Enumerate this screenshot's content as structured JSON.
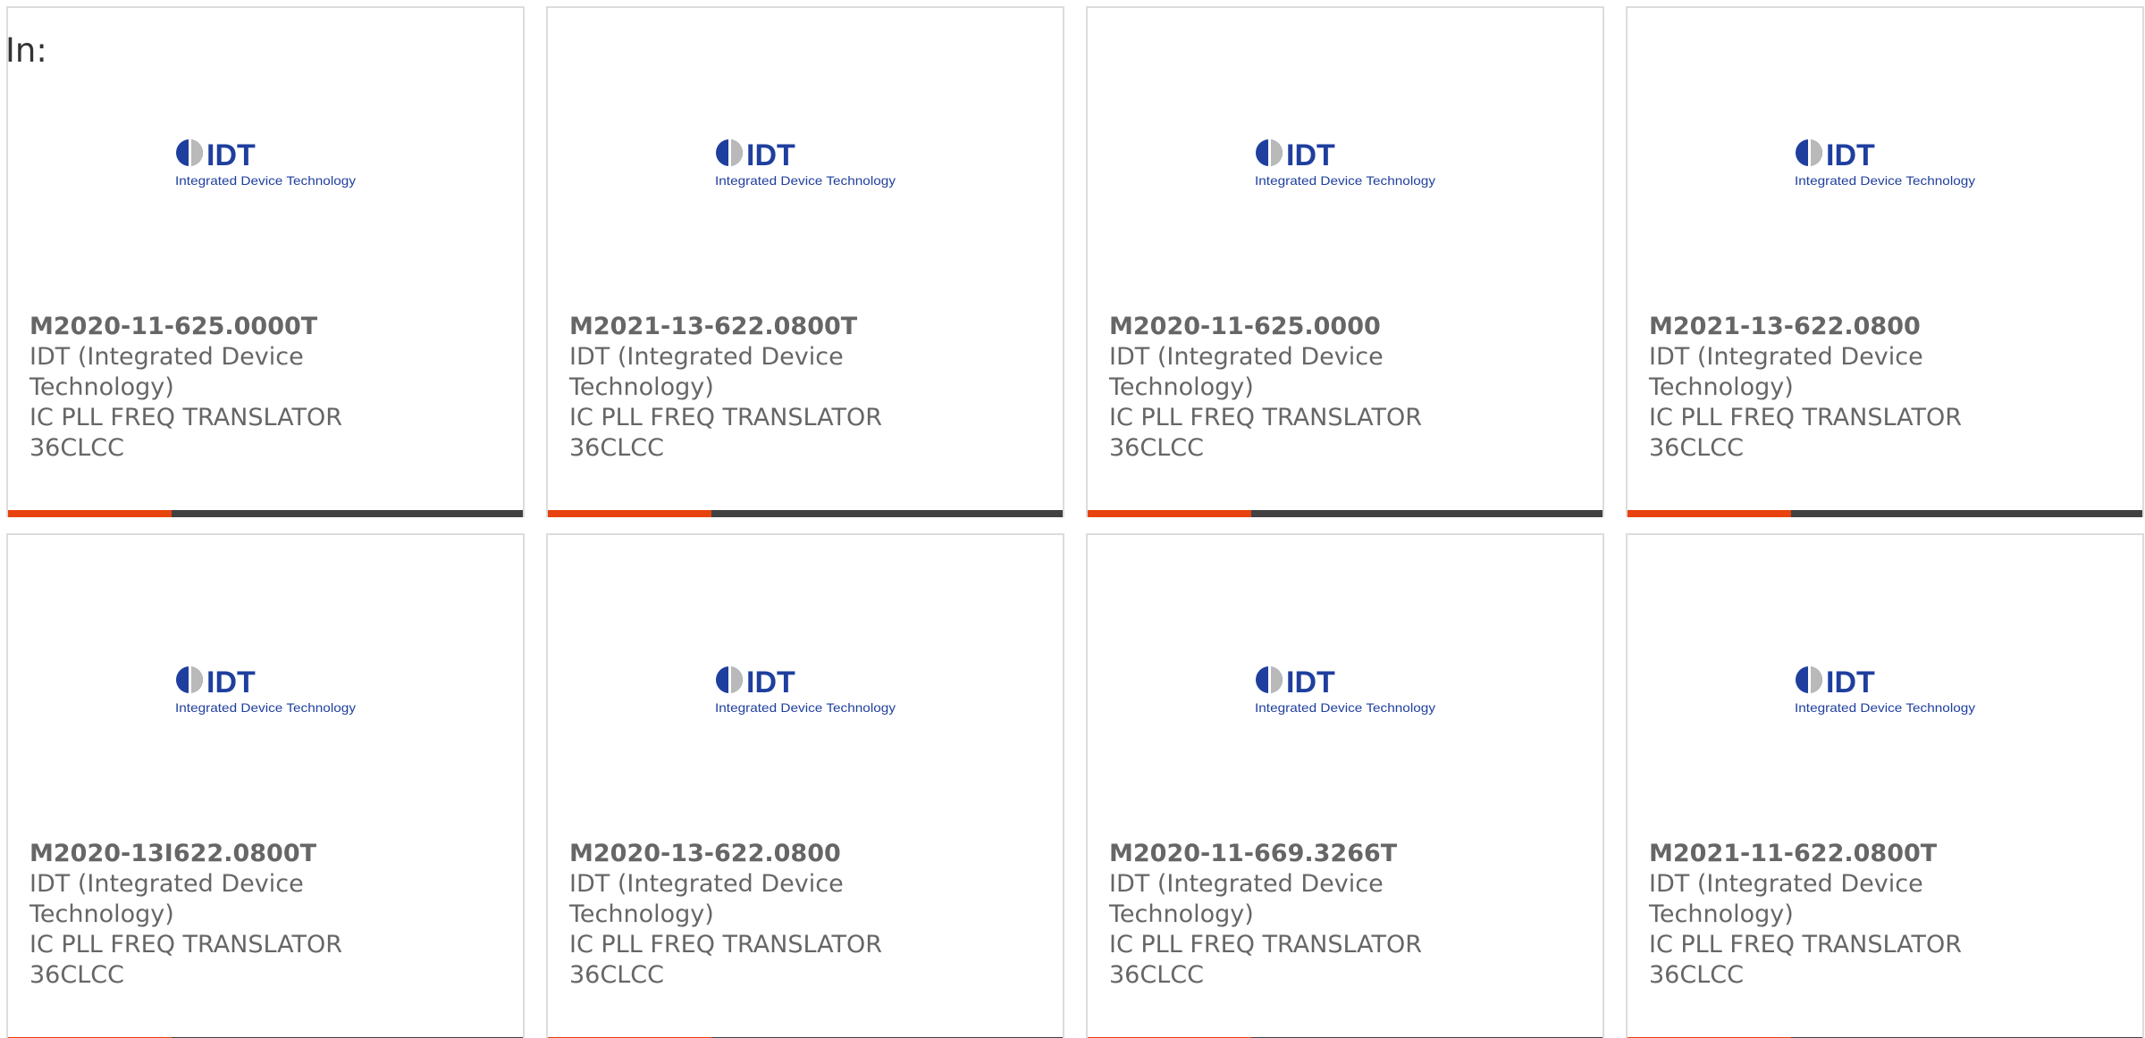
{
  "header": {
    "label": "In:"
  },
  "logo": {
    "brand": "IDT",
    "tagline": "Integrated Device Technology",
    "color": "#1f3f9e"
  },
  "colors": {
    "accent": "#e8420e",
    "bar": "#414141",
    "text": "#666666",
    "border": "#dcdcdc"
  },
  "products": [
    {
      "part": "M2020-11-625.0000T",
      "manufacturer": "IDT (Integrated Device Technology)",
      "description": "IC PLL FREQ TRANSLATOR 36CLCC"
    },
    {
      "part": "M2021-13-622.0800T",
      "manufacturer": "IDT (Integrated Device Technology)",
      "description": "IC PLL FREQ TRANSLATOR 36CLCC"
    },
    {
      "part": "M2020-11-625.0000",
      "manufacturer": "IDT (Integrated Device Technology)",
      "description": "IC PLL FREQ TRANSLATOR 36CLCC"
    },
    {
      "part": "M2021-13-622.0800",
      "manufacturer": "IDT (Integrated Device Technology)",
      "description": "IC PLL FREQ TRANSLATOR 36CLCC"
    },
    {
      "part": "M2020-13I622.0800T",
      "manufacturer": "IDT (Integrated Device Technology)",
      "description": "IC PLL FREQ TRANSLATOR 36CLCC"
    },
    {
      "part": "M2020-13-622.0800",
      "manufacturer": "IDT (Integrated Device Technology)",
      "description": "IC PLL FREQ TRANSLATOR 36CLCC"
    },
    {
      "part": "M2020-11-669.3266T",
      "manufacturer": "IDT (Integrated Device Technology)",
      "description": "IC PLL FREQ TRANSLATOR 36CLCC"
    },
    {
      "part": "M2021-11-622.0800T",
      "manufacturer": "IDT (Integrated Device Technology)",
      "description": "IC PLL FREQ TRANSLATOR 36CLCC"
    }
  ]
}
